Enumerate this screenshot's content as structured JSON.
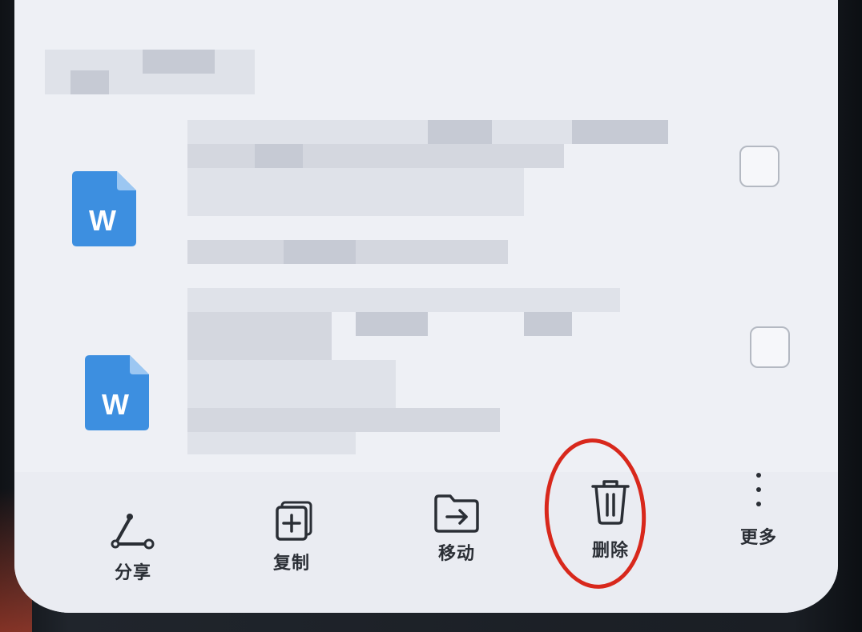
{
  "files": [
    {
      "icon": "word-doc-icon",
      "icon_letter": "W",
      "selected": false
    },
    {
      "icon": "word-doc-icon",
      "icon_letter": "W",
      "selected": false
    }
  ],
  "toolbar": {
    "share_label": "分享",
    "copy_label": "复制",
    "move_label": "移动",
    "delete_label": "删除",
    "more_label": "更多"
  },
  "colors": {
    "word_blue": "#3d8fe0",
    "highlight_red": "#d8281c",
    "screen_bg": "#eef0f5"
  }
}
